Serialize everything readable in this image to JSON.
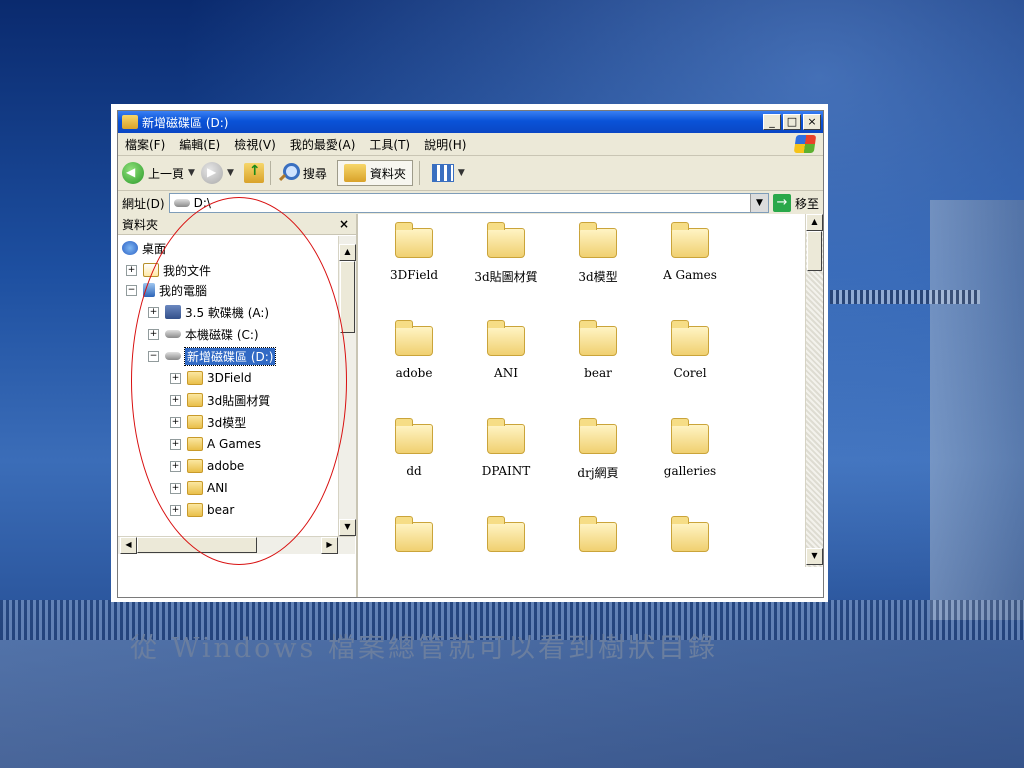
{
  "window": {
    "title": "新增磁碟區 (D:)",
    "controls": [
      "_",
      "□",
      "×"
    ]
  },
  "menu": [
    "檔案(F)",
    "編輯(E)",
    "檢視(V)",
    "我的最愛(A)",
    "工具(T)",
    "說明(H)"
  ],
  "toolbar": {
    "back_label": "上一頁",
    "search_label": "搜尋",
    "folders_label": "資料夾"
  },
  "address": {
    "label": "網址(D)",
    "value": "D:\\",
    "go_label": "移至"
  },
  "tree": {
    "header": "資料夾",
    "close": "×",
    "nodes": [
      {
        "label": "桌面",
        "icon": "desktop-icon",
        "expander": ""
      },
      {
        "label": "我的文件",
        "icon": "my-documents-icon",
        "expander": "+"
      },
      {
        "label": "我的電腦",
        "icon": "my-computer-icon",
        "expander": "−"
      },
      {
        "label": "3.5 軟碟機 (A:)",
        "icon": "floppy-drive-icon",
        "expander": "+"
      },
      {
        "label": "本機磁碟 (C:)",
        "icon": "hard-drive-icon",
        "expander": "+"
      },
      {
        "label": "新增磁碟區 (D:)",
        "icon": "hard-drive-icon",
        "expander": "−",
        "selected": true
      },
      {
        "label": "3DField",
        "icon": "folder-icon",
        "expander": "+"
      },
      {
        "label": "3d貼圖材質",
        "icon": "folder-icon",
        "expander": "+"
      },
      {
        "label": "3d模型",
        "icon": "folder-icon",
        "expander": "+"
      },
      {
        "label": "A Games",
        "icon": "folder-icon",
        "expander": "+"
      },
      {
        "label": "adobe",
        "icon": "folder-icon",
        "expander": "+"
      },
      {
        "label": "ANI",
        "icon": "folder-icon",
        "expander": "+"
      },
      {
        "label": "bear",
        "icon": "folder-icon",
        "expander": "+"
      }
    ]
  },
  "files": [
    "3DField",
    "3d貼圖材質",
    "3d模型",
    "A Games",
    "adobe",
    "ANI",
    "bear",
    "Corel",
    "dd",
    "DPAINT",
    "drj網頁",
    "galleries",
    "",
    "",
    "",
    ""
  ],
  "caption": "從 Windows 檔案總管就可以看到樹狀目錄",
  "colors": {
    "annotation": "#d81010",
    "selection": "#316ac5",
    "titlebar": "#0a53d8"
  }
}
